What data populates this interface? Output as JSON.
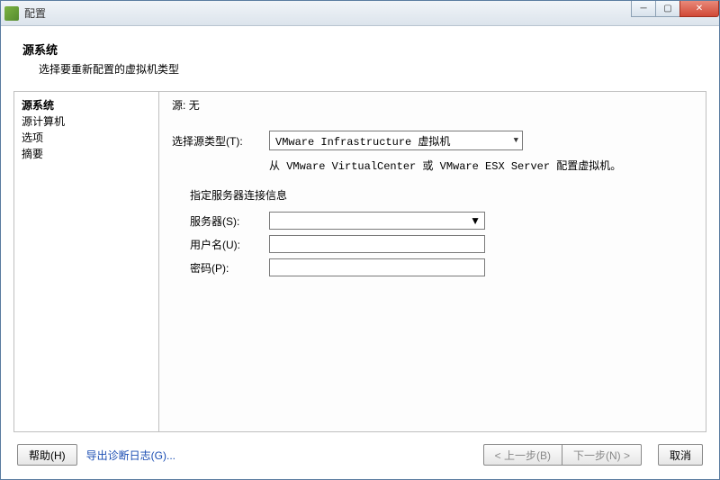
{
  "titlebar": {
    "title": "配置"
  },
  "header": {
    "title": "源系统",
    "subtitle": "选择要重新配置的虚拟机类型"
  },
  "sidebar": {
    "steps": [
      "源系统",
      "源计算机",
      "选项",
      "摘要"
    ]
  },
  "pane": {
    "source_label": "源:",
    "source_value": "无",
    "type_label": "选择源类型(T):",
    "type_value": "VMware Infrastructure 虚拟机",
    "hint": "从 VMware VirtualCenter 或 VMware ESX Server 配置虚拟机。",
    "group_title": "指定服务器连接信息",
    "server_label": "服务器(S):",
    "server_value": "",
    "user_label": "用户名(U):",
    "user_value": "",
    "pass_label": "密码(P):",
    "pass_value": ""
  },
  "footer": {
    "help": "帮助(H)",
    "export": "导出诊断日志(G)...",
    "back": "< 上一步(B)",
    "next": "下一步(N) >",
    "cancel": "取消"
  }
}
